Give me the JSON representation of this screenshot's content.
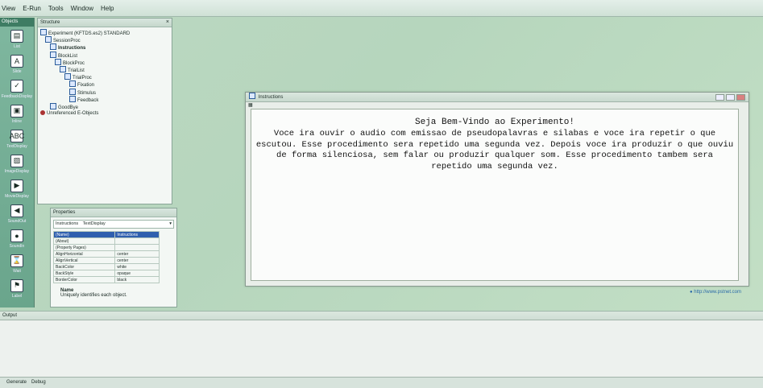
{
  "menubar": [
    "View",
    "E-Run",
    "Tools",
    "Window",
    "Help"
  ],
  "toolbox": {
    "title": "Objects",
    "items": [
      "List",
      "Slide",
      "FeedbackDisplay",
      "Inline",
      "TextDisplay",
      "ImageDisplay",
      "MovieDisplay",
      "SoundOut",
      "SoundIn",
      "Wait",
      "Label"
    ]
  },
  "structure": {
    "title": "Structure",
    "close": "×",
    "tree": [
      {
        "indent": 0,
        "label": "Experiment (KFTDS.es2) STANDARD",
        "bold": false,
        "icon": "experiment-icon"
      },
      {
        "indent": 1,
        "label": "SessionProc",
        "bold": false,
        "icon": "procedure-icon"
      },
      {
        "indent": 2,
        "label": "Instructions",
        "bold": true,
        "icon": "textdisplay-icon"
      },
      {
        "indent": 2,
        "label": "BlockList",
        "bold": false,
        "icon": "list-icon"
      },
      {
        "indent": 3,
        "label": "BlockProc",
        "bold": false,
        "icon": "procedure-icon"
      },
      {
        "indent": 4,
        "label": "TrialList",
        "bold": false,
        "icon": "list-icon"
      },
      {
        "indent": 5,
        "label": "TrialProc",
        "bold": false,
        "icon": "procedure-icon"
      },
      {
        "indent": 6,
        "label": "Fixation",
        "bold": false,
        "icon": "textdisplay-icon"
      },
      {
        "indent": 6,
        "label": "Stimulus",
        "bold": false,
        "icon": "textdisplay-icon"
      },
      {
        "indent": 6,
        "label": "Feedback",
        "bold": false,
        "icon": "textdisplay-icon"
      },
      {
        "indent": 2,
        "label": "GoodBye",
        "bold": false,
        "icon": "textdisplay-icon"
      },
      {
        "indent": 0,
        "label": "Unreferenced E-Objects",
        "bold": false,
        "icon": "unreferenced-icon"
      }
    ]
  },
  "properties": {
    "title": "Properties",
    "object_name": "Instructions",
    "object_type": "TextDisplay",
    "rows": [
      {
        "name": "(Name)",
        "value": "Instructions"
      },
      {
        "name": "(About)",
        "value": ""
      },
      {
        "name": "(Property Pages)",
        "value": ""
      },
      {
        "name": "AlignHorizontal",
        "value": "center"
      },
      {
        "name": "AlignVertical",
        "value": "center"
      },
      {
        "name": "BackColor",
        "value": "white"
      },
      {
        "name": "BackStyle",
        "value": "opaque"
      },
      {
        "name": "BorderColor",
        "value": "black"
      }
    ],
    "desc_name": "Name",
    "desc_text": "Uniquely identifies each object."
  },
  "instructions_window": {
    "title": "Instructions",
    "heading": "Seja Bem-Vindo ao Experimento!",
    "body": "Voce ira ouvir o audio com emissao de pseudopalavras e silabas e voce ira repetir o que escutou. Esse procedimento sera repetido uma segunda vez. Depois voce ira produzir o que ouviu de forma silenciosa, sem falar ou produzir qualquer som. Esse procedimento tambem sera repetido uma segunda vez."
  },
  "url_link": "http://www.pstnet.com",
  "output": {
    "title": "Output"
  },
  "bottom_tabs": [
    "Generate",
    "Debug"
  ]
}
